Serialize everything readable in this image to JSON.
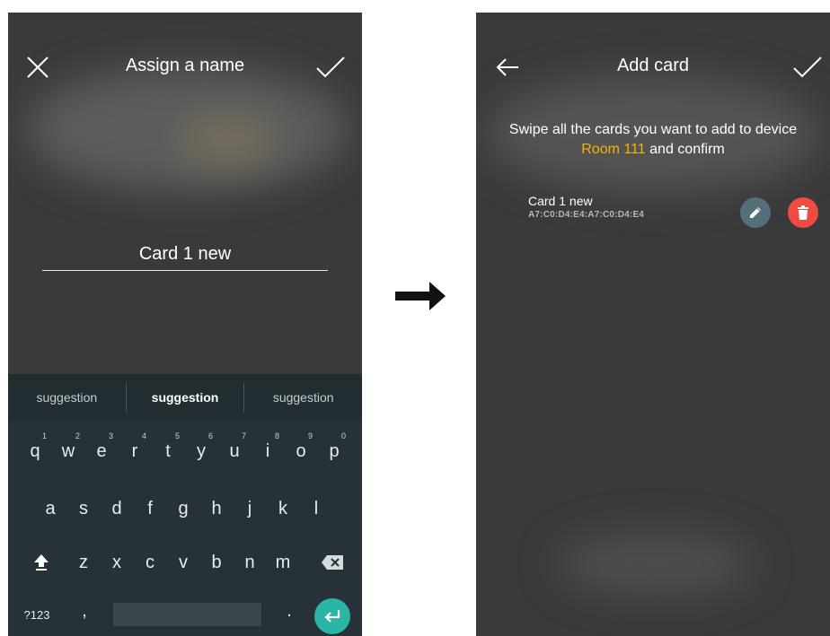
{
  "left_screen": {
    "title": "Assign a name",
    "name_value": "Card 1 new",
    "suggestions": [
      "suggestion",
      "suggestion",
      "suggestion"
    ],
    "keyboard": {
      "row1": [
        {
          "key": "q",
          "hint": "1"
        },
        {
          "key": "w",
          "hint": "2"
        },
        {
          "key": "e",
          "hint": "3"
        },
        {
          "key": "r",
          "hint": "4"
        },
        {
          "key": "t",
          "hint": "5"
        },
        {
          "key": "y",
          "hint": "6"
        },
        {
          "key": "u",
          "hint": "7"
        },
        {
          "key": "i",
          "hint": "8"
        },
        {
          "key": "o",
          "hint": "9"
        },
        {
          "key": "p",
          "hint": "0"
        }
      ],
      "row2": [
        "a",
        "s",
        "d",
        "f",
        "g",
        "h",
        "j",
        "k",
        "l"
      ],
      "row3": [
        "z",
        "x",
        "c",
        "v",
        "b",
        "n",
        "m"
      ],
      "symbols_key": "?123",
      "comma_key": ",",
      "period_key": "."
    }
  },
  "right_screen": {
    "title": "Add card",
    "instruction_prefix": "Swipe all the cards you want to add to device ",
    "instruction_highlight": "Room 111",
    "instruction_suffix": " and confirm",
    "highlight_color": "#f5b400",
    "cards": [
      {
        "name": "Card 1 new",
        "mac": "A7:C0:D4:E4:A7:C0:D4:E4"
      }
    ]
  },
  "icons": {
    "close": "close-icon",
    "confirm": "check-icon",
    "back": "back-arrow-icon",
    "edit": "pencil-icon",
    "delete": "trash-icon",
    "shift": "shift-icon",
    "backspace": "backspace-icon",
    "enter": "enter-icon",
    "transition": "right-arrow-icon"
  },
  "colors": {
    "screen_bg": "#3a3a3a",
    "keyboard_bg": "#263238",
    "enter_key": "#2bb5a6",
    "edit_button": "#546e7a",
    "delete_button": "#ef4b43"
  }
}
